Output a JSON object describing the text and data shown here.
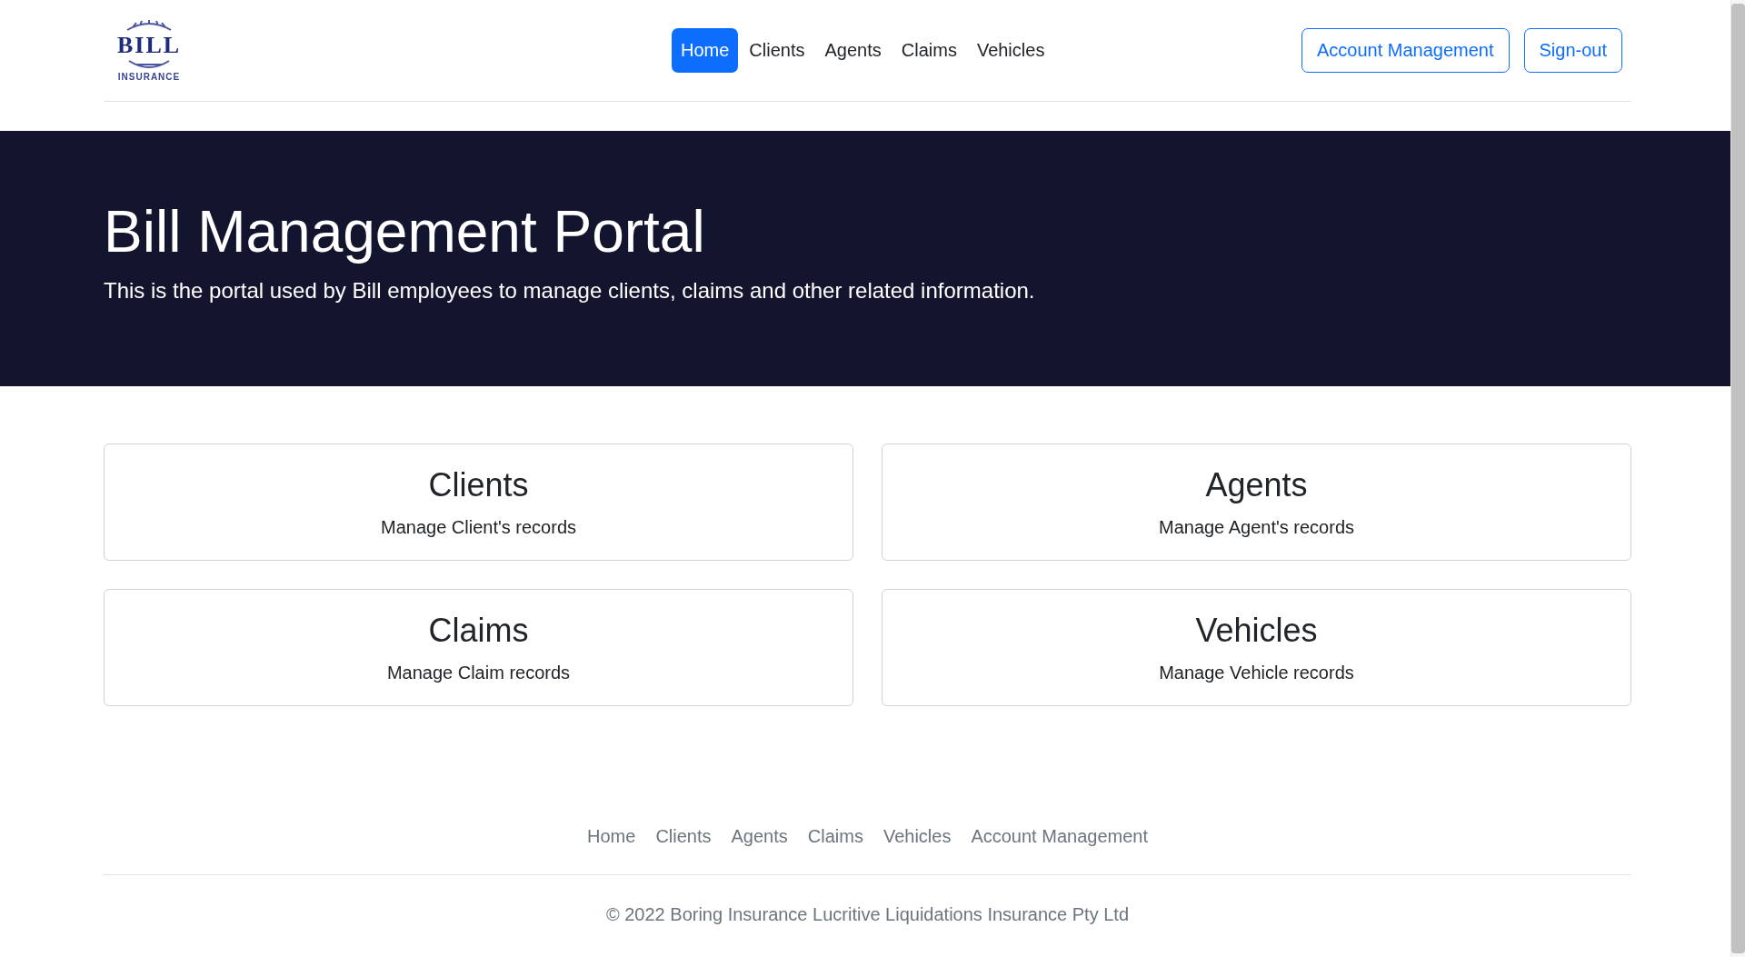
{
  "logo": {
    "wordmark": "BILL",
    "tagline": "INSURANCE"
  },
  "nav": [
    {
      "label": "Home",
      "selected": true
    },
    {
      "label": "Clients",
      "selected": false
    },
    {
      "label": "Agents",
      "selected": false
    },
    {
      "label": "Claims",
      "selected": false
    },
    {
      "label": "Vehicles",
      "selected": false
    }
  ],
  "header_buttons": [
    "Account Management",
    "Sign-out"
  ],
  "hero": {
    "title": "Bill Management Portal",
    "subtitle": "This is the portal used by Bill employees to manage clients, claims and other related information."
  },
  "cards": [
    {
      "title": "Clients",
      "description": "Manage Client's records"
    },
    {
      "title": "Agents",
      "description": "Manage Agent's records"
    },
    {
      "title": "Claims",
      "description": "Manage Claim records"
    },
    {
      "title": "Vehicles",
      "description": "Manage Vehicle records"
    }
  ],
  "footer_links": [
    "Home",
    "Clients",
    "Agents",
    "Claims",
    "Vehicles",
    "Account Management"
  ],
  "copyright": "© 2022 Boring Insurance Lucritive Liquidations Insurance Pty Ltd"
}
